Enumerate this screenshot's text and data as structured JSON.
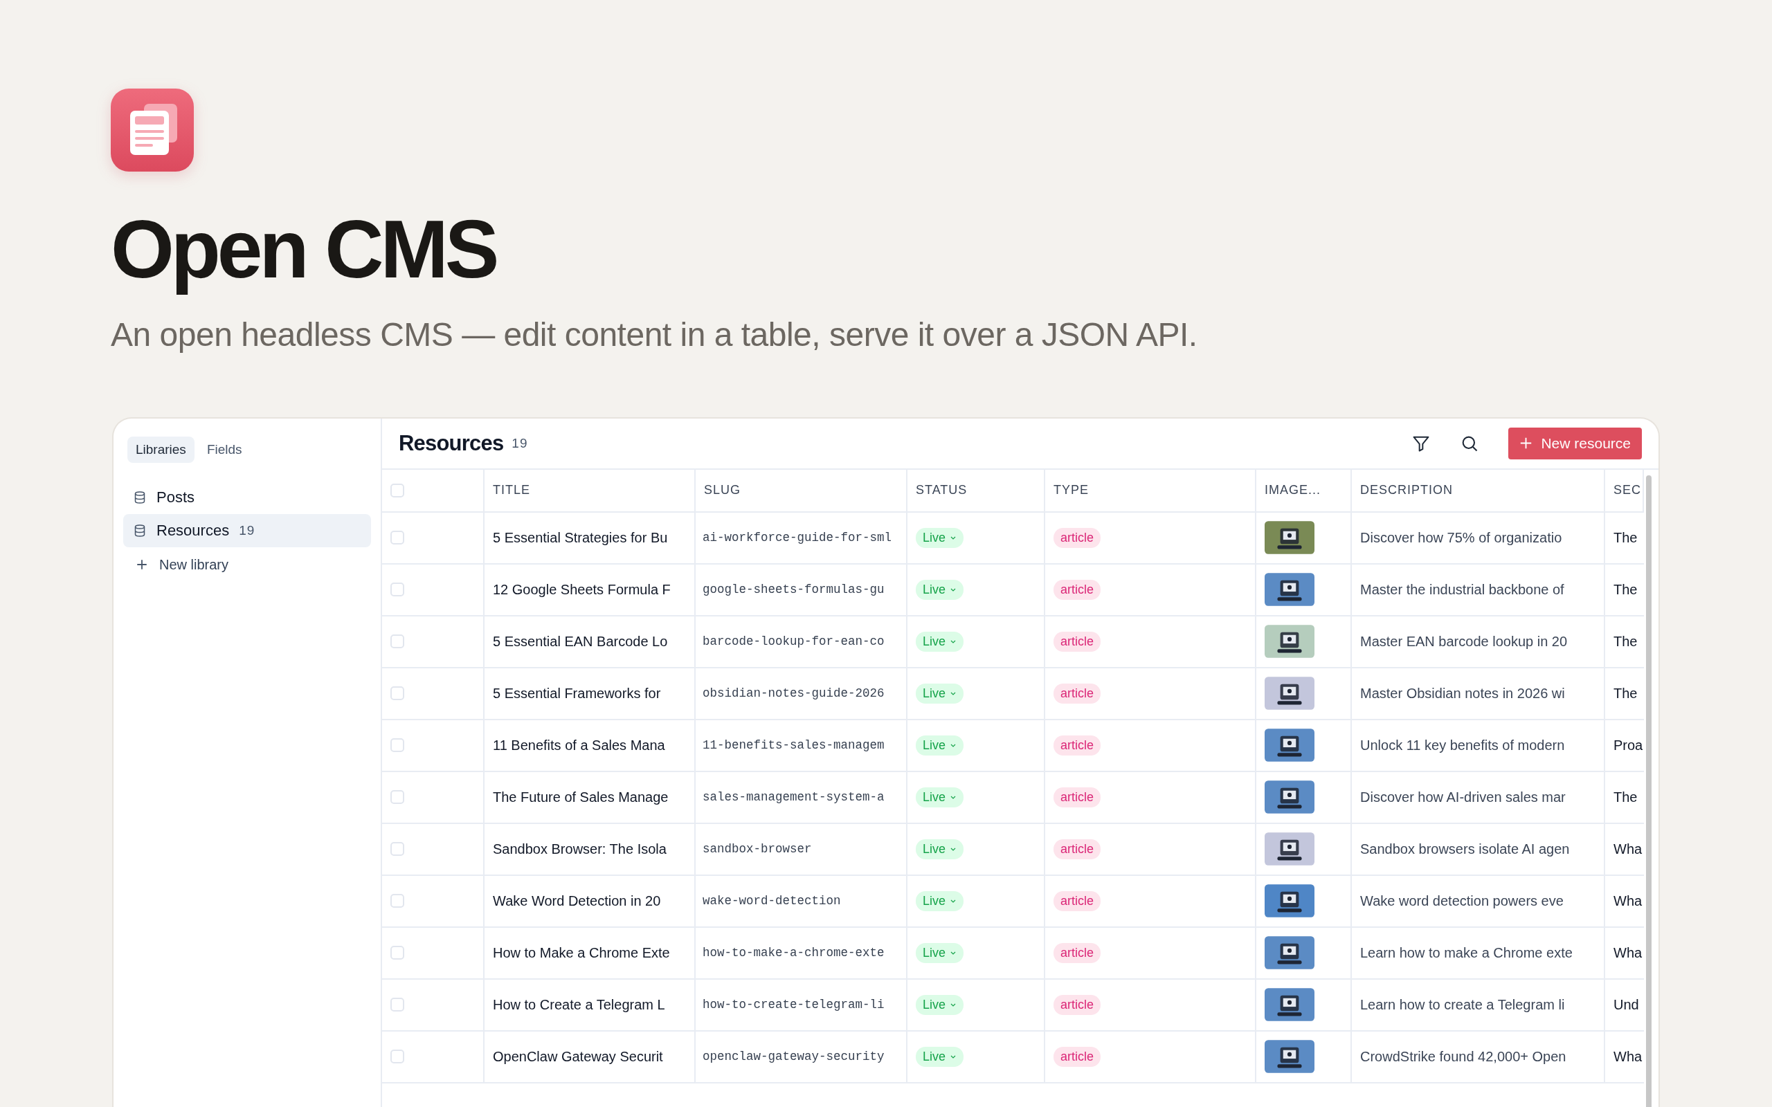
{
  "hero": {
    "title": "Open CMS",
    "subtitle": "An open headless CMS — edit content in a table, serve it over a JSON API."
  },
  "sidebar": {
    "tabs": [
      {
        "label": "Libraries",
        "selected": true
      },
      {
        "label": "Fields",
        "selected": false
      }
    ],
    "libraries": [
      {
        "name": "Posts",
        "selected": false
      },
      {
        "name": "Resources",
        "count": "19",
        "selected": true
      }
    ],
    "new_library": "New library"
  },
  "header": {
    "title": "Resources",
    "count": "19",
    "new_button": "New resource"
  },
  "table": {
    "select_all": {
      "checked": false
    },
    "columns": [
      "TITLE",
      "SLUG",
      "STATUS",
      "TYPE",
      "IMAGE...",
      "DESCRIPTION",
      "SEC"
    ],
    "rows": [
      {
        "checked": false,
        "title": "5 Essential Strategies for Bu",
        "slug": "ai-workforce-guide-for-sml",
        "status": "Live",
        "type": "article",
        "description": "Discover how 75% of organizatio",
        "section": "The"
      },
      {
        "checked": false,
        "title": "12 Google Sheets Formula F",
        "slug": "google-sheets-formulas-gu",
        "status": "Live",
        "type": "article",
        "description": "Master the industrial backbone of",
        "section": "The"
      },
      {
        "checked": false,
        "title": "5 Essential EAN Barcode Lo",
        "slug": "barcode-lookup-for-ean-co",
        "status": "Live",
        "type": "article",
        "description": "Master EAN barcode lookup in 20",
        "section": "The"
      },
      {
        "checked": false,
        "title": "5 Essential Frameworks for",
        "slug": "obsidian-notes-guide-2026",
        "status": "Live",
        "type": "article",
        "description": "Master Obsidian notes in 2026 wi",
        "section": "The"
      },
      {
        "checked": false,
        "title": "11 Benefits of a Sales Mana",
        "slug": "11-benefits-sales-managem",
        "status": "Live",
        "type": "article",
        "description": "Unlock 11 key benefits of modern",
        "section": "Proa"
      },
      {
        "checked": false,
        "title": "The Future of Sales Manage",
        "slug": "sales-management-system-a",
        "status": "Live",
        "type": "article",
        "description": "Discover how AI-driven sales mar",
        "section": "The"
      },
      {
        "checked": false,
        "title": "Sandbox Browser: The Isola",
        "slug": "sandbox-browser",
        "status": "Live",
        "type": "article",
        "description": "Sandbox browsers isolate AI agen",
        "section": "Wha"
      },
      {
        "checked": false,
        "title": "Wake Word Detection in 20",
        "slug": "wake-word-detection",
        "status": "Live",
        "type": "article",
        "description": "Wake word detection powers eve",
        "section": "Wha"
      },
      {
        "checked": false,
        "title": "How to Make a Chrome Exte",
        "slug": "how-to-make-a-chrome-exte",
        "status": "Live",
        "type": "article",
        "description": "Learn how to make a Chrome exte",
        "section": "Wha"
      },
      {
        "checked": false,
        "title": "How to Create a Telegram L",
        "slug": "how-to-create-telegram-li",
        "status": "Live",
        "type": "article",
        "description": "Learn how to create a Telegram li",
        "section": "Und"
      },
      {
        "checked": false,
        "title": "OpenClaw Gateway Securit",
        "slug": "openclaw-gateway-security",
        "status": "Live",
        "type": "article",
        "description": "CrowdStrike found 42,000+ Open",
        "section": "Wha"
      }
    ]
  }
}
